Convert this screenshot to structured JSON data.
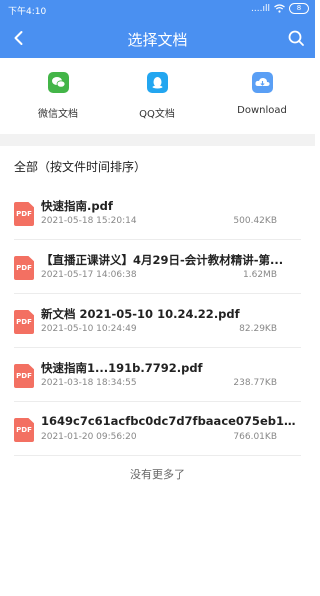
{
  "status": {
    "time": "下午4:10",
    "signal": "....ıll",
    "battery": "8"
  },
  "nav": {
    "title": "选择文档"
  },
  "sources": [
    {
      "label": "微信文档",
      "icon": "wechat-icon",
      "color": "#43b548"
    },
    {
      "label": "QQ文档",
      "icon": "qq-icon",
      "color": "#23a6f0"
    },
    {
      "label": "Download",
      "icon": "cloud-download-icon",
      "color": "#5a9ff5"
    }
  ],
  "section_title": "全部（按文件时间排序）",
  "files": [
    {
      "name": "快速指南.pdf",
      "date": "2021-05-18 15:20:14",
      "size": "500.42KB",
      "badge": "PDF"
    },
    {
      "name": "【直播正课讲义】4月29日-会计教材精讲-第...",
      "date": "2021-05-17 14:06:38",
      "size": "1.62MB",
      "badge": "PDF"
    },
    {
      "name": "新文档 2021-05-10 10.24.22.pdf",
      "date": "2021-05-10 10:24:49",
      "size": "82.29KB",
      "badge": "PDF"
    },
    {
      "name": "快速指南1...191b.7792.pdf",
      "date": "2021-03-18 18:34:55",
      "size": "238.77KB",
      "badge": "PDF"
    },
    {
      "name": "1649c7c61acfbc0dc7d7fbaace075eb1.pdf",
      "date": "2021-01-20 09:56:20",
      "size": "766.01KB",
      "badge": "PDF"
    }
  ],
  "footer": {
    "no_more": "没有更多了"
  }
}
